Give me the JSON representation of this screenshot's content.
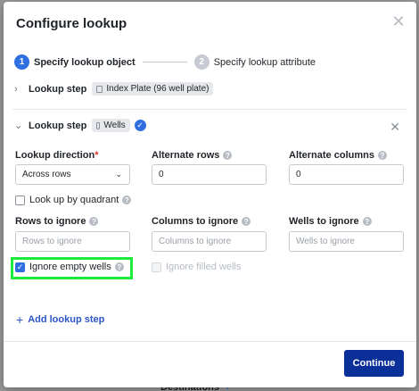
{
  "modal": {
    "title": "Configure lookup",
    "close_icon": "close-icon"
  },
  "stepper": {
    "steps": [
      {
        "number": "1",
        "label": "Specify lookup object",
        "active": true
      },
      {
        "number": "2",
        "label": "Specify lookup attribute",
        "active": false
      }
    ]
  },
  "lookup_steps": [
    {
      "label": "Lookup step",
      "chip": "Index Plate (96 well plate)",
      "expanded": false
    },
    {
      "label": "Lookup step",
      "chip": "Wells",
      "expanded": true
    }
  ],
  "form": {
    "lookup_direction": {
      "label": "Lookup direction",
      "required_mark": "*",
      "value": "Across rows"
    },
    "alternate_rows": {
      "label": "Alternate rows",
      "value": "0"
    },
    "alternate_columns": {
      "label": "Alternate columns",
      "value": "0"
    },
    "look_up_by_quadrant": {
      "label": "Look up by quadrant",
      "checked": false
    },
    "rows_to_ignore": {
      "label": "Rows to ignore",
      "placeholder": "Rows to ignore"
    },
    "columns_to_ignore": {
      "label": "Columns to ignore",
      "placeholder": "Columns to ignore"
    },
    "wells_to_ignore": {
      "label": "Wells to ignore",
      "placeholder": "Wells to ignore"
    },
    "ignore_empty_wells": {
      "label": "Ignore empty wells",
      "checked": true
    },
    "ignore_filled_wells": {
      "label": "Ignore filled wells",
      "checked": false,
      "disabled": true
    }
  },
  "add_lookup_step": "Add lookup step",
  "continue_label": "Continue",
  "background": {
    "destinations_label": "Destinations"
  },
  "colors": {
    "primary": "#2f6fe0",
    "continue_bg": "#0b2f99",
    "highlight": "#1aeb3c"
  }
}
